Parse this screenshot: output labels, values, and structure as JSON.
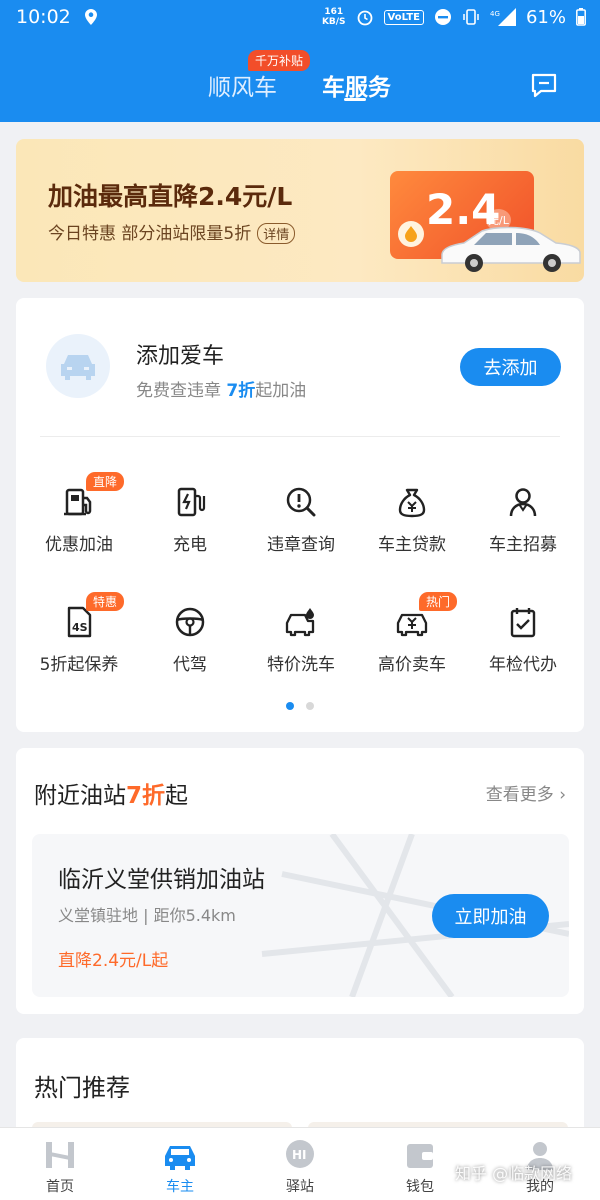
{
  "status_bar": {
    "time": "10:02",
    "speed_top": "161",
    "speed_bottom": "KB/S",
    "volte": "VoLTE",
    "network": "4G",
    "battery": "61%"
  },
  "header": {
    "tab_shunfeng": "顺风车",
    "tab_service": "车服务",
    "badge": "千万补贴"
  },
  "banner": {
    "title": "加油最高直降2.4元/L",
    "subtitle": "今日特惠 部分油站限量5折",
    "detail": "详情",
    "card_value": "2.4",
    "card_unit": "元/L"
  },
  "add_car": {
    "title": "添加爱车",
    "sub_prefix": "免费查违章 ",
    "sub_highlight": "7折",
    "sub_suffix": "起加油",
    "button": "去添加"
  },
  "services": [
    {
      "label": "优惠加油",
      "tag": "直降",
      "icon": "gas-pump-icon"
    },
    {
      "label": "充电",
      "tag": "",
      "icon": "charger-icon"
    },
    {
      "label": "违章查询",
      "tag": "",
      "icon": "violation-search-icon"
    },
    {
      "label": "车主贷款",
      "tag": "",
      "icon": "money-bag-icon"
    },
    {
      "label": "车主招募",
      "tag": "",
      "icon": "driver-person-icon"
    },
    {
      "label": "5折起保养",
      "tag": "特惠",
      "icon": "4s-maintenance-icon"
    },
    {
      "label": "代驾",
      "tag": "",
      "icon": "steering-wheel-icon"
    },
    {
      "label": "特价洗车",
      "tag": "",
      "icon": "car-wash-icon"
    },
    {
      "label": "高价卖车",
      "tag": "热门",
      "icon": "sell-car-icon"
    },
    {
      "label": "年检代办",
      "tag": "",
      "icon": "inspection-calendar-icon"
    }
  ],
  "pager": {
    "pages": 2,
    "current": 1
  },
  "nearby": {
    "title_prefix": "附近油站",
    "title_highlight": "7折",
    "title_suffix": "起",
    "more": "查看更多"
  },
  "station": {
    "name": "临沂义堂供销加油站",
    "address": "义堂镇驻地 | 距你5.4km",
    "price": "直降2.4元/L起",
    "button": "立即加油"
  },
  "hot": {
    "title": "热门推荐"
  },
  "tabbar": [
    {
      "label": "首页",
      "icon": "home-logo-icon",
      "active": false
    },
    {
      "label": "车主",
      "icon": "car-icon",
      "active": true
    },
    {
      "label": "驿站",
      "icon": "hi-station-icon",
      "active": false
    },
    {
      "label": "钱包",
      "icon": "wallet-icon",
      "active": false
    },
    {
      "label": "我的",
      "icon": "profile-icon",
      "active": false
    }
  ],
  "watermark": "知乎 @临款网络",
  "colors": {
    "primary": "#1a8cf0",
    "accent": "#fe6a2a",
    "banner_bg": "#fbe7b8"
  }
}
